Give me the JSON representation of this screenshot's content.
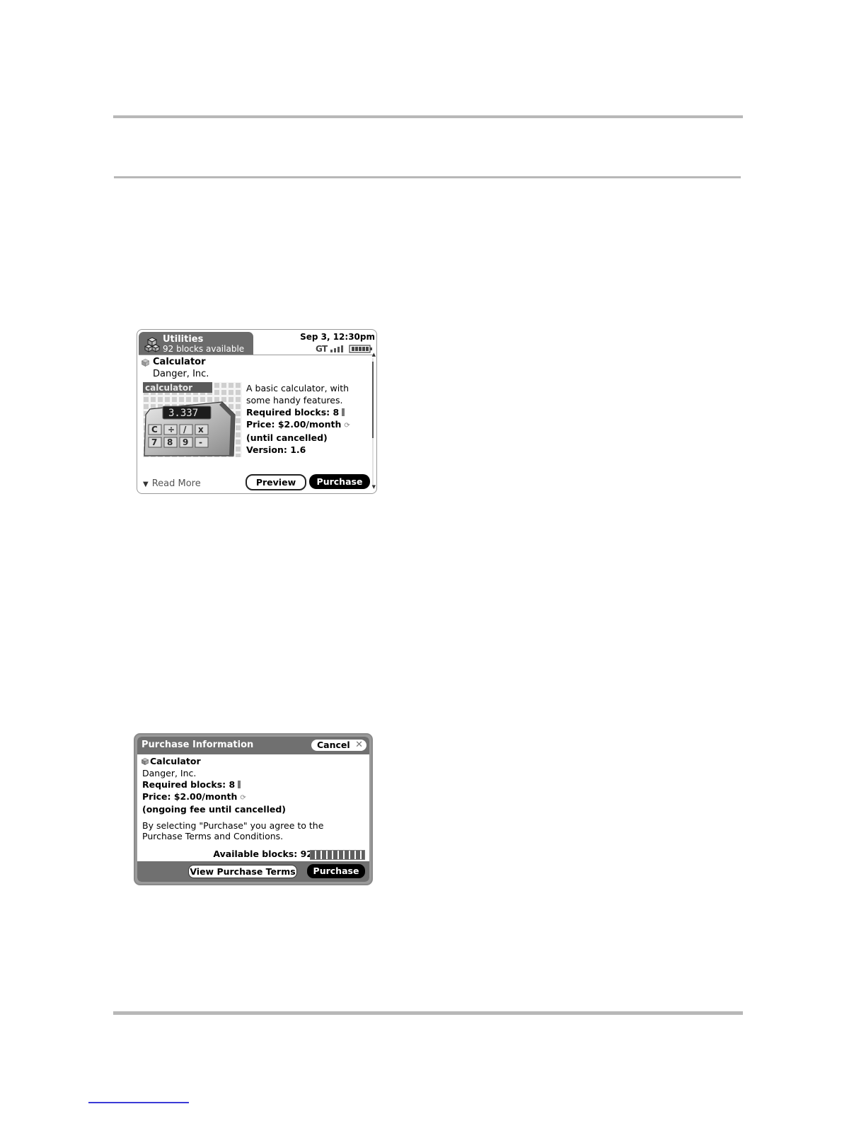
{
  "screen1": {
    "category": "Utilities",
    "blocks_available": "92 blocks available",
    "datetime": "Sep 3, 12:30pm",
    "app_name": "Calculator",
    "developer": "Danger, Inc.",
    "artwork_label": "calculator",
    "artwork_display": "3.337",
    "description_line1": "A basic calculator, with",
    "description_line2": "some handy features.",
    "required_blocks": "Required blocks: 8",
    "price": "Price: $2.00/month",
    "price_note": "(until cancelled)",
    "version": "Version: 1.6",
    "read_more": "Read More",
    "preview_button": "Preview",
    "purchase_button": "Purchase",
    "scroll_position": 0.0
  },
  "screen2": {
    "title": "Purchase Information",
    "cancel_button": "Cancel",
    "app_name": "Calculator",
    "developer": "Danger, Inc.",
    "required_blocks": "Required blocks: 8",
    "price": "Price: $2.00/month",
    "price_note": "(ongoing fee until cancelled)",
    "agreement": "By selecting \"Purchase\" you agree to the Purchase Terms and Conditions.",
    "available_blocks": "Available blocks: 92",
    "view_terms_button": "View Purchase Terms",
    "purchase_button": "Purchase"
  },
  "icons": {
    "category": "cubes-icon",
    "network": "signal-icon",
    "battery": "battery-icon",
    "app": "gem-icon",
    "renew": "renew-icon",
    "read_more": "triangle-down-icon",
    "close": "close-icon"
  },
  "colors": {
    "header_gray": "#6b6b6b",
    "button_black": "#000000",
    "rule_gray": "#b8b8b8",
    "link_blue": "#3b3bd6"
  }
}
